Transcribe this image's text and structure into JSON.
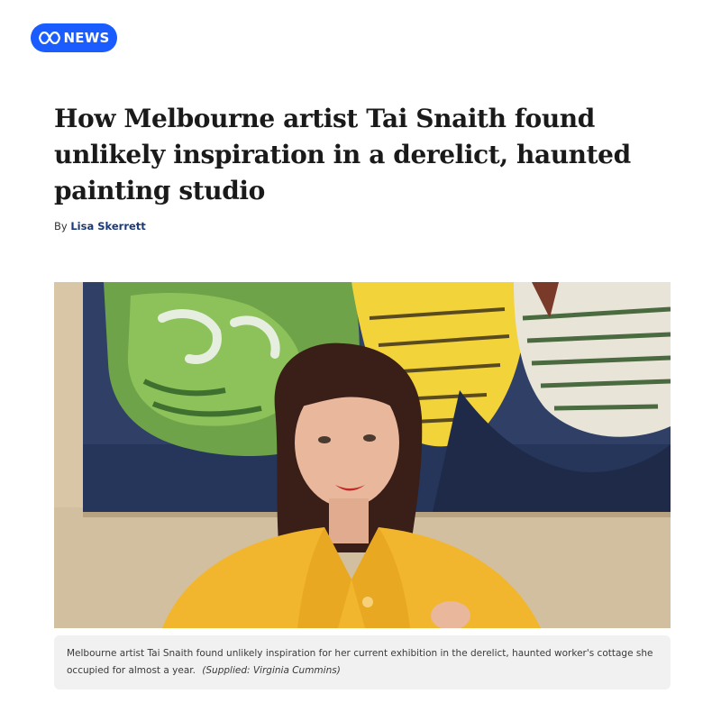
{
  "header": {
    "logo_text": "NEWS",
    "logo_icon": "abc-lissajous-logo",
    "brand_color": "#1b5cff"
  },
  "article": {
    "headline": "How Melbourne artist Tai Snaith found unlikely inspiration in a derelict, haunted painting studio",
    "byline_prefix": "By",
    "author": "Lisa Skerrett",
    "author_color": "#1a3a7a"
  },
  "image": {
    "caption": "Melbourne artist Tai Snaith found unlikely inspiration for her current exhibition in the derelict, haunted worker's cottage she occupied for almost a year.",
    "credit": "(Supplied: Virginia Cummins)"
  }
}
